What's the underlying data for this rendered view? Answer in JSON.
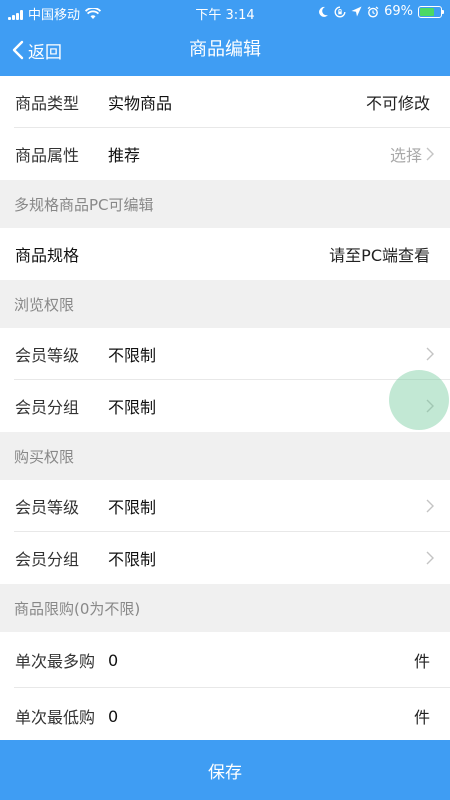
{
  "status_bar": {
    "carrier": "中国移动",
    "time": "下午 3:14",
    "battery": "69%",
    "battery_level": 0.69
  },
  "nav": {
    "back_label": "返回",
    "title": "商品编辑"
  },
  "product_type": {
    "label": "商品类型",
    "value": "实物商品",
    "right": "不可修改"
  },
  "product_attr": {
    "label": "商品属性",
    "value": "推荐",
    "action": "选择"
  },
  "section_multi_spec": "多规格商品PC可编辑",
  "product_spec": {
    "label": "商品规格",
    "right": "请至PC端查看"
  },
  "section_browse": "浏览权限",
  "browse": {
    "level_label": "会员等级",
    "level_value": "不限制",
    "group_label": "会员分组",
    "group_value": "不限制"
  },
  "section_purchase": "购买权限",
  "purchase": {
    "level_label": "会员等级",
    "level_value": "不限制",
    "group_label": "会员分组",
    "group_value": "不限制"
  },
  "section_limit": "商品限购(0为不限)",
  "limit": {
    "max_label": "单次最多购",
    "max_value": "0",
    "max_unit": "件",
    "min_label": "单次最低购",
    "min_value": "0",
    "min_unit": "件"
  },
  "save_label": "保存",
  "colors": {
    "primary": "#3f9df3",
    "background": "#f0f0f0",
    "muted": "#888888"
  },
  "icons": [
    "wifi-icon",
    "moon-icon",
    "orientation-lock-icon",
    "location-icon",
    "alarm-icon",
    "battery-icon",
    "back-chevron-icon",
    "chevron-right-icon"
  ]
}
